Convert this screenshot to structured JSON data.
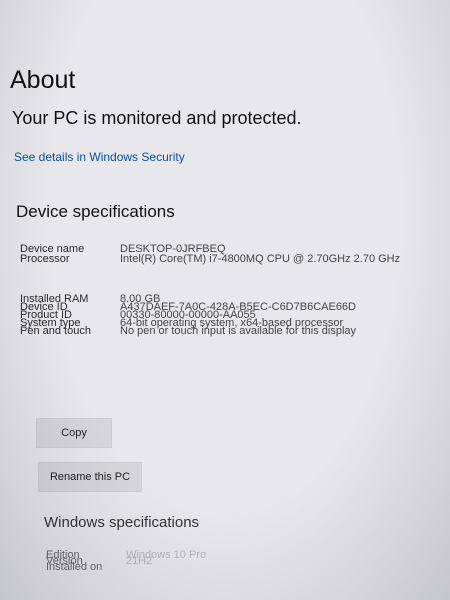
{
  "header": {
    "title": "About",
    "protection_status": "Your PC is monitored and protected.",
    "security_link": "See details in Windows Security"
  },
  "device_specs": {
    "heading": "Device specifications",
    "rows": [
      {
        "label": "Device name",
        "value": "DESKTOP-0JRFBEQ"
      },
      {
        "label": "Processor",
        "value": "Intel(R) Core(TM) i7-4800MQ CPU @ 2.70GHz   2.70 GHz"
      },
      {
        "label": "Installed RAM",
        "value": "8.00 GB"
      },
      {
        "label": "Device ID",
        "value": "A437DAEF-7A0C-428A-B5EC-C6D7B6CAE66D"
      },
      {
        "label": "Product ID",
        "value": "00330-80000-00000-AA055"
      },
      {
        "label": "System type",
        "value": "64-bit operating system, x64-based processor"
      },
      {
        "label": "Pen and touch",
        "value": "No pen or touch input is available for this display"
      }
    ]
  },
  "buttons": {
    "copy": "Copy",
    "rename": "Rename this PC"
  },
  "windows_specs": {
    "heading": "Windows specifications",
    "rows": [
      {
        "label": "Edition",
        "value": "Windows 10 Pro"
      },
      {
        "label": "Version",
        "value": "21H2"
      },
      {
        "label": "Installed on",
        "value": ""
      }
    ]
  },
  "colors": {
    "background": "#e8e8ec",
    "link": "#0b4fa6",
    "button": "#d6d6da"
  }
}
